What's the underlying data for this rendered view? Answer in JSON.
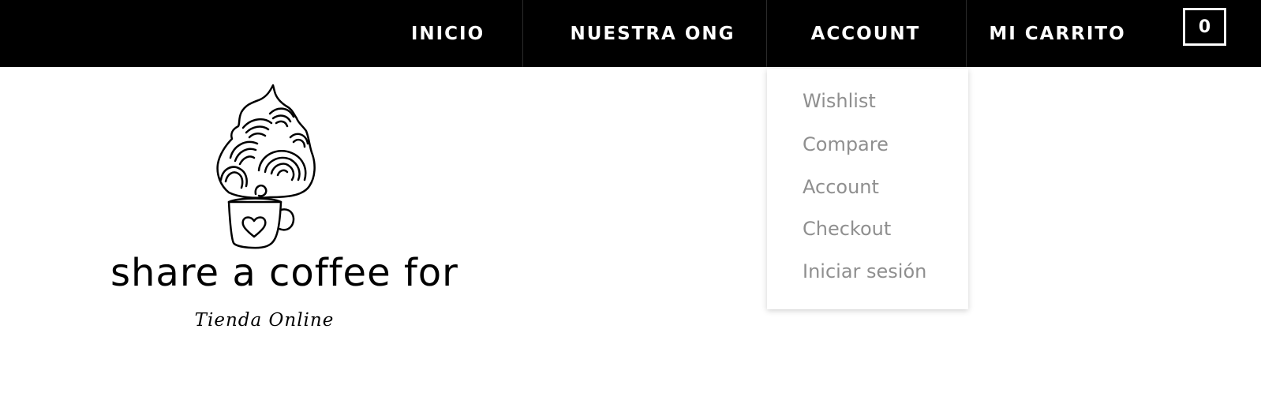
{
  "nav": {
    "items": [
      {
        "label": "INICIO"
      },
      {
        "label": "NUESTRA ONG"
      },
      {
        "label": "ACCOUNT"
      },
      {
        "label": "MI CARRITO"
      }
    ],
    "cart_count": "0"
  },
  "account_menu": {
    "items": [
      {
        "label": "Wishlist"
      },
      {
        "label": "Compare"
      },
      {
        "label": "Account"
      },
      {
        "label": "Checkout"
      },
      {
        "label": "Iniciar sesión"
      }
    ]
  },
  "logo": {
    "title": "share a coffee for",
    "subtitle": "Tienda Online",
    "icon": "coffee-cup-with-heart-and-swirl-leaf-icon"
  },
  "colors": {
    "nav_background": "#000000",
    "nav_text": "#ffffff",
    "menu_text": "#8f8f8f",
    "page_background": "#ffffff"
  }
}
